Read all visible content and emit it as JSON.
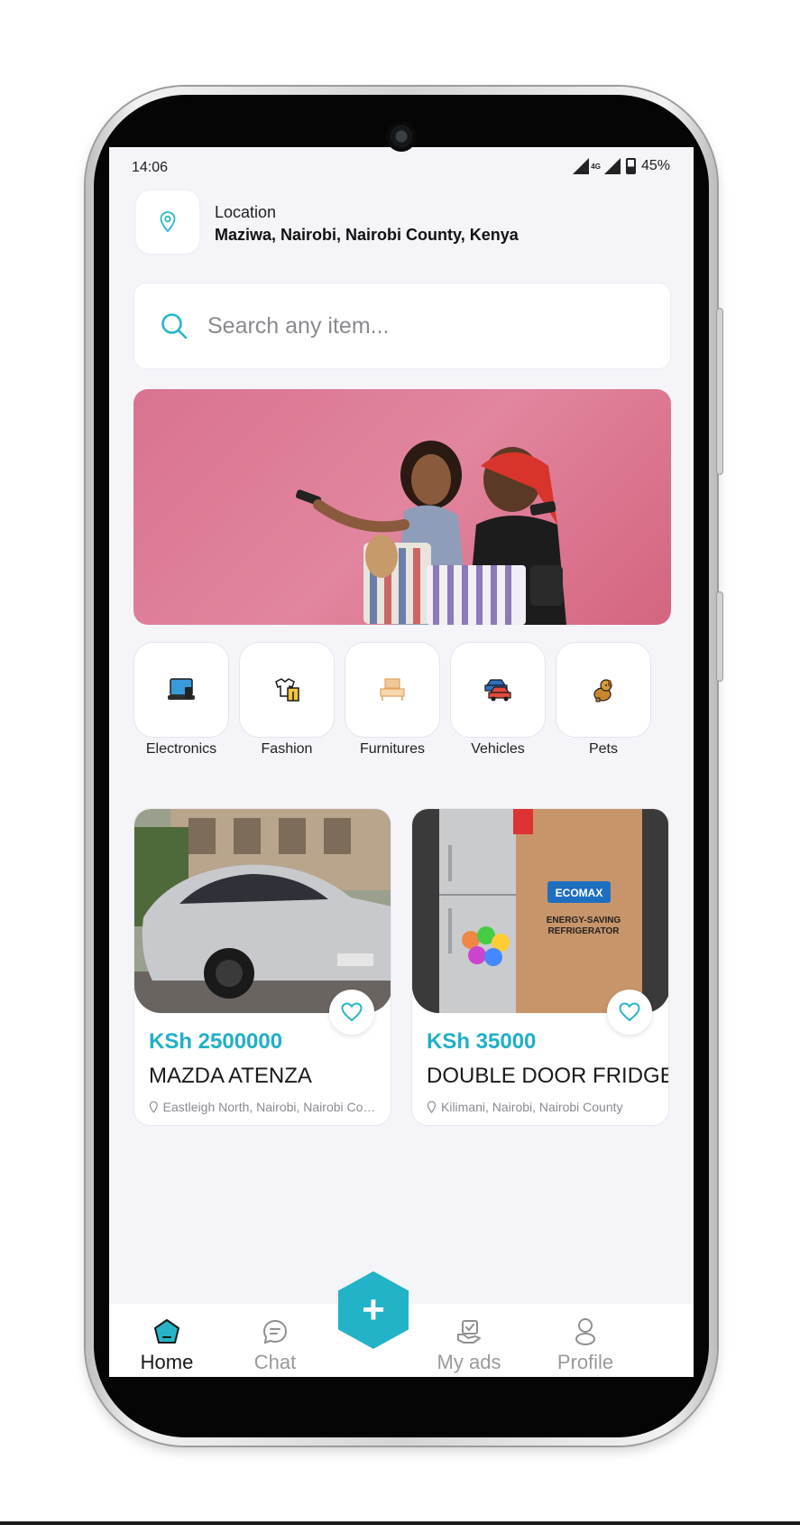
{
  "status_bar": {
    "time": "14:06",
    "network": "4G",
    "battery": "45%"
  },
  "location": {
    "label": "Location",
    "value": "Maziwa, Nairobi, Nairobi County, Kenya"
  },
  "search": {
    "placeholder": "Search any item..."
  },
  "banner": {
    "description_icon": "shopping-women-banner-image"
  },
  "categories": [
    {
      "label": "Electronics",
      "icon": "laptop-icon"
    },
    {
      "label": "Fashion",
      "icon": "clothes-icon"
    },
    {
      "label": "Furnitures",
      "icon": "furniture-icon"
    },
    {
      "label": "Vehicles",
      "icon": "cars-icon"
    },
    {
      "label": "Pets",
      "icon": "dog-icon"
    }
  ],
  "listings": [
    {
      "price": "KSh 2500000",
      "title": "MAZDA ATENZA",
      "location": "Eastleigh North, Nairobi, Nairobi County"
    },
    {
      "price": "KSh 35000",
      "title": "DOUBLE DOOR FRIDGE",
      "location": "Kilimani, Nairobi, Nairobi County"
    }
  ],
  "fridge_photo_text": {
    "brand": "ECOMAX",
    "line1": "ENERGY-SAVING",
    "line2": "REFRIGERATOR"
  },
  "bottom_nav": {
    "home": "Home",
    "chat": "Chat",
    "add": "+",
    "my_ads": "My ads",
    "profile": "Profile"
  },
  "colors": {
    "accent": "#22b3c8",
    "price": "#1fb0c7",
    "background": "#f4f4f9"
  }
}
